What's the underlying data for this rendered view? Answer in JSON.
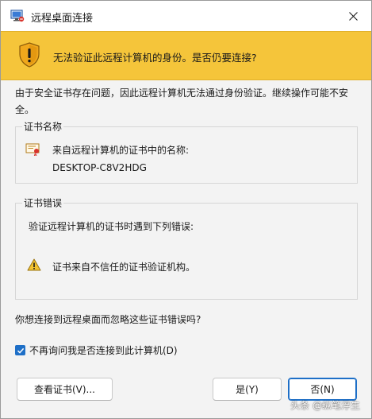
{
  "window": {
    "title": "远程桌面连接"
  },
  "banner": {
    "text": "无法验证此远程计算机的身份。是否仍要连接?"
  },
  "description": "由于安全证书存在问题，因此远程计算机无法通过身份验证。继续操作可能不安全。",
  "cert_group": {
    "title": "证书名称",
    "line1": "来自远程计算机的证书中的名称:",
    "line2": "DESKTOP-C8V2HDG"
  },
  "error_group": {
    "title": "证书错误",
    "intro": "验证远程计算机的证书时遇到下列错误:",
    "item": "证书来自不信任的证书验证机构。"
  },
  "question": "你想连接到远程桌面而忽略这些证书错误吗?",
  "checkbox": {
    "label": "不再询问我是否连接到此计算机(D)",
    "checked": true
  },
  "buttons": {
    "view_cert": "查看证书(V)...",
    "yes": "是(Y)",
    "no": "否(N)"
  },
  "watermark": "头条 @纵笔浮生",
  "colors": {
    "banner": "#f5c53a",
    "accent": "#1e6fc7"
  }
}
